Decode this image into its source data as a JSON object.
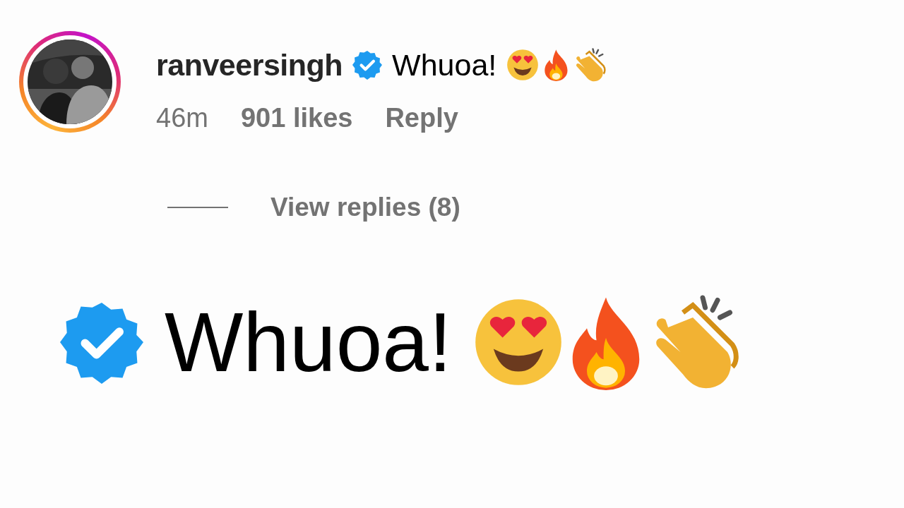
{
  "comment": {
    "username": "ranveersingh",
    "verified": true,
    "text": "Whuoa!",
    "time": "46m",
    "likes": "901 likes",
    "reply": "Reply"
  },
  "view_replies": "View replies (8)",
  "zoom_inset": {
    "verified": true,
    "text": "Whuoa!"
  }
}
